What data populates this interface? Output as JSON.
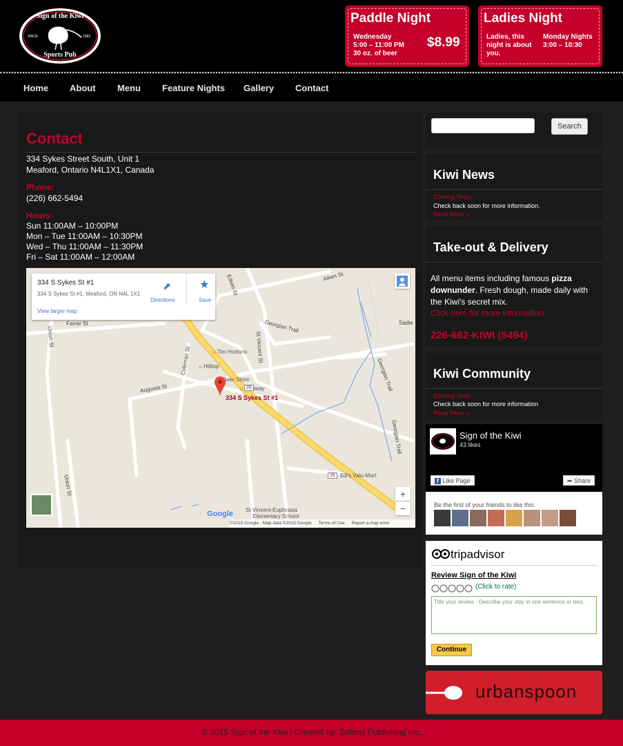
{
  "logo": {
    "name_line1": "Sign of the Kiwi",
    "name_line2": "Sports Pub",
    "since": "SINCE",
    "year": "1982"
  },
  "promos": [
    {
      "title": "Paddle Night",
      "lines": [
        "Wednesday",
        "5:00 – 11:00 PM",
        "30 oz. of beer"
      ],
      "price": "$8.99"
    },
    {
      "title": "Ladies Night",
      "lines": [
        "Ladies, this",
        "night is about",
        "you."
      ],
      "side_lines": [
        "Monday Nights",
        "3:00 – 10:30"
      ]
    }
  ],
  "nav": [
    "Home",
    "About",
    "Menu",
    "Feature Nights",
    "Gallery",
    "Contact"
  ],
  "contact": {
    "title": "Contact",
    "address_line1": "334 Sykes Street South, Unit 1",
    "address_line2": "Meaford, Ontario N4L1X1, Canada",
    "phone_label": "Phone:",
    "phone": "(226) 662-5494",
    "hours_label": "Hours:",
    "hours": [
      "Sun 11:00AM – 10:00PM",
      "Mon – Tue 11:00AM – 10:30PM",
      "Wed – Thu 11:00AM – 11:30PM",
      "Fri – Sat 11:00AM – 12:00AM"
    ]
  },
  "map": {
    "card_title": "334 S Sykes St #1",
    "card_address": "334 S Sykes St #1, Meaford, ON N4L 1X1",
    "larger_map": "View larger map",
    "directions": "Directions",
    "save": "Save",
    "marker_label": "334 S Sykes St #1",
    "labels": {
      "edwin": "Edwin St",
      "aiken": "Aiken St",
      "farrar": "Farrar St",
      "union1": "Union St",
      "union2": "Union St",
      "coleman": "Coleman St",
      "st_vincent": "St Vincent St",
      "georgian_trail1": "Georgian Trail",
      "georgian_trail2": "Georgian Trail",
      "georgian_trail3": "Georgian Trail",
      "sadie": "Sadie",
      "tim_hortons": "Tim Hortons",
      "hilltop": "Hilltop",
      "beer_store": "Beer Store",
      "subway": "Subway",
      "augusta": "Augusta St",
      "route": "26",
      "bills": "Bill's Valu-Mart",
      "school1": "St Vincent-Euphrasia",
      "school2": "Elementary School"
    },
    "brand": "Google",
    "footer": [
      "©2015 Google - Map data ©2015 Google",
      "Terms of Use",
      "Report a map error"
    ],
    "zoom_in": "+",
    "zoom_out": "−"
  },
  "search": {
    "placeholder": "",
    "button": "Search"
  },
  "kiwi_news": {
    "title": "Kiwi News",
    "coming": "Coming Soon...",
    "text": "Check back soon for more information.",
    "more": "Read More »"
  },
  "takeout": {
    "title": "Take-out & Delivery",
    "text_a": "All menu items including famous",
    "text_b": "pizza",
    "text_c": "downunder",
    "text_d": ". Fresh dough, made daily with",
    "text_e": "the Kiwi's secret mix.",
    "link": "Click here for more information",
    "phone": "226-662-KIWI (5494)"
  },
  "kiwi_community": {
    "title": "Kiwi Community",
    "coming": "Coming Soon...",
    "text": "Check back soon for more information",
    "more": "Read More »"
  },
  "facebook": {
    "page_name": "Sign of the Kiwi",
    "likes": "43 likes",
    "like_btn": "Like Page",
    "share_btn": "Share",
    "friends_text": "Be the first of your friends to like this"
  },
  "tripadvisor": {
    "brand": "tripadvisor",
    "review_title": "Review Sign of the Kiwi",
    "rate_text": "(Click to rate)",
    "placeholder": "Title your review - Describe your stay in one sentence or less.",
    "button": "Continue"
  },
  "urbanspoon": {
    "text": "urbanspoon"
  },
  "footer": {
    "text": "© 2015 Sign of the Kiwi | Created by: Softext Publishing Inc."
  },
  "colors": {
    "brand_red": "#c4002b",
    "background": "#1f1f1f",
    "panel": "#191919"
  }
}
